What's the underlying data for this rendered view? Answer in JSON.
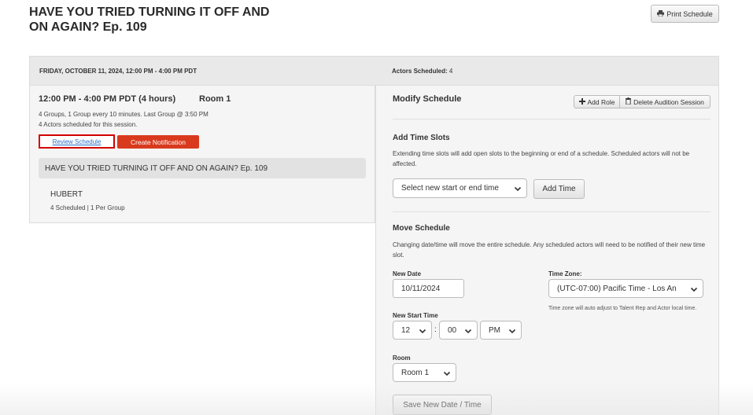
{
  "page": {
    "title": "HAVE YOU TRIED TURNING IT OFF AND ON AGAIN? Ep. 109",
    "print_label": "Print Schedule"
  },
  "header": {
    "date_range": "FRIDAY, OCTOBER 11, 2024, 12:00 PM - 4:00 PM PDT",
    "actors_label": "Actors Scheduled:",
    "actors_count": "4"
  },
  "session": {
    "time": "12:00 PM - 4:00 PM PDT (4 hours)",
    "room": "Room 1",
    "groups_info": "4 Groups, 1 Group every 10 minutes. Last Group @ 3:50 PM",
    "actors_info": "4 Actors scheduled for this session.",
    "review_label": "Review Schedule",
    "notify_label": "Create Notification",
    "project_name": "HAVE YOU TRIED TURNING IT OFF AND ON AGAIN? Ep. 109",
    "role_name": "HUBERT",
    "role_info": "4 Scheduled | 1 Per Group"
  },
  "modify": {
    "title": "Modify Schedule",
    "add_role_label": "Add Role",
    "delete_label": "Delete Audition Session"
  },
  "add_time": {
    "title": "Add Time Slots",
    "description": "Extending time slots will add open slots to the beginning or end of a schedule. Scheduled actors will not be affected.",
    "select_value": "Select new start or end time",
    "button_label": "Add Time"
  },
  "move": {
    "title": "Move Schedule",
    "description": "Changing date/time will move the entire schedule. Any scheduled actors will need to be notified of their new time slot.",
    "new_date_label": "New Date",
    "new_date_value": "10/11/2024",
    "timezone_label": "Time Zone:",
    "timezone_value": "(UTC-07:00) Pacific Time - Los An",
    "timezone_note": "Time zone will auto adjust to Talent Rep and Actor local time.",
    "start_time_label": "New Start Time",
    "hour": "12",
    "minute": "00",
    "ampm": "PM",
    "colon": ":",
    "room_label": "Room",
    "room_value": "Room 1",
    "save_label": "Save New Date / Time"
  }
}
